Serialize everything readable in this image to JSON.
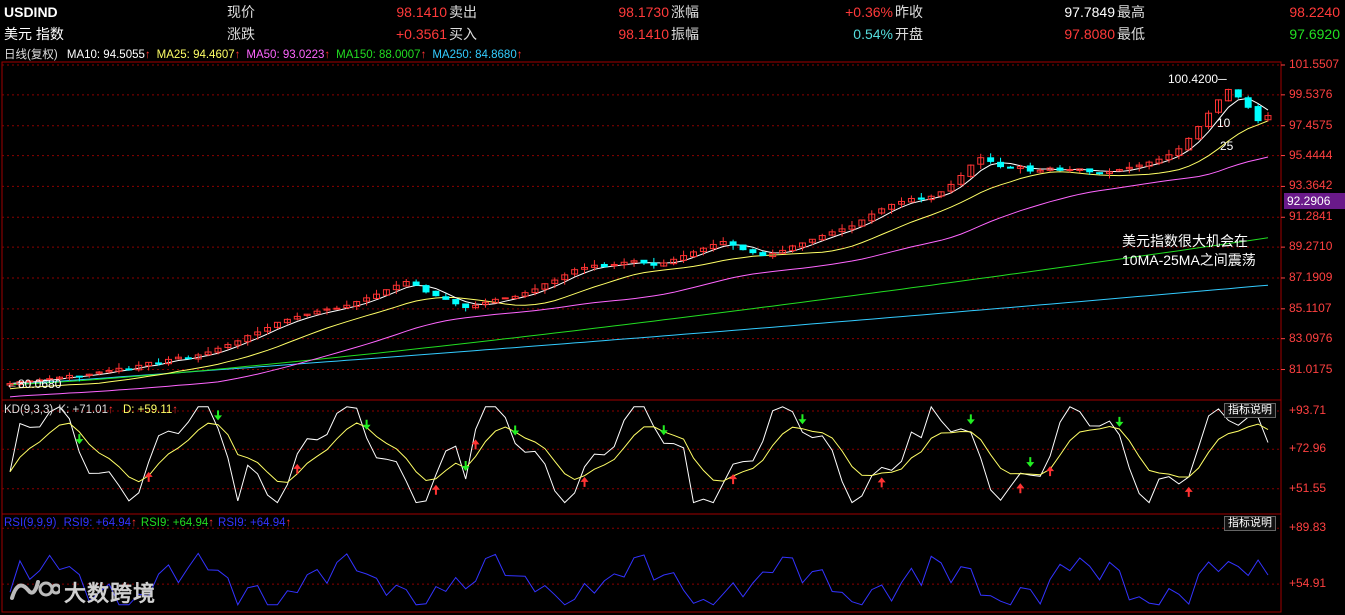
{
  "quote": {
    "symbol": "USDIND",
    "name": "美元 指数",
    "rows": [
      [
        {
          "label": "现价",
          "value": "98.1410"
        },
        {
          "label": "卖出",
          "value": "98.1730"
        },
        {
          "label": "涨幅",
          "value": "+0.36%"
        },
        {
          "label": "昨收",
          "value": "97.7849"
        },
        {
          "label": "最高",
          "value": "98.2240"
        }
      ],
      [
        {
          "label": "涨跌",
          "value": "+0.3561"
        },
        {
          "label": "买入",
          "value": "98.1410"
        },
        {
          "label": "振幅",
          "value": "0.54%"
        },
        {
          "label": "开盘",
          "value": "97.8080"
        },
        {
          "label": "最低",
          "value": "97.6920"
        }
      ]
    ]
  },
  "ma_bar": {
    "title": "日线(复权)",
    "items": [
      {
        "text": "MA10: 94.5055",
        "color": "#ffffff"
      },
      {
        "text": "MA25: 94.4607",
        "color": "#ffff66"
      },
      {
        "text": "MA50: 93.0223",
        "color": "#ff66ff"
      },
      {
        "text": "MA150: 88.0007",
        "color": "#22dd22"
      },
      {
        "text": "MA250: 84.8680",
        "color": "#33ccff"
      }
    ]
  },
  "colors": {
    "up": "#ff3333",
    "down": "#00ffff",
    "grid": "#8b0000",
    "axis": "#ff4040",
    "ma10": "#ffffff",
    "ma25": "#ffff66",
    "ma50": "#ff66ff",
    "ma150": "#22dd22",
    "ma250": "#33ccff",
    "rsi": "#3333ff"
  },
  "chart_data": [
    {
      "type": "candlestick",
      "title": "",
      "yticks": [
        "101.5507",
        "99.5376",
        "97.4575",
        "95.4444",
        "93.3642",
        "91.2841",
        "89.2710",
        "87.1909",
        "85.1107",
        "83.0976",
        "81.0175"
      ],
      "ylim": [
        79.3,
        101.5507
      ],
      "last_price": "92.2906",
      "annotations": {
        "high": "100.4200",
        "low": "80.0680",
        "ma10_tag": "10",
        "ma25_tag": "25",
        "note_line1": "美元指数很大机会在",
        "note_line2": "10MA-25MA之间震荡"
      },
      "closes": [
        80.07,
        80.2,
        80.25,
        80.32,
        80.4,
        80.5,
        80.62,
        80.55,
        80.7,
        80.85,
        80.95,
        81.1,
        81.05,
        81.3,
        81.5,
        81.45,
        81.7,
        81.85,
        81.8,
        82.0,
        82.2,
        82.45,
        82.7,
        82.95,
        83.3,
        83.55,
        83.85,
        84.2,
        84.4,
        84.6,
        84.75,
        84.95,
        85.1,
        85.15,
        85.35,
        85.6,
        85.85,
        86.1,
        86.4,
        86.7,
        86.95,
        86.7,
        86.25,
        86.0,
        85.75,
        85.45,
        85.2,
        85.35,
        85.55,
        85.75,
        85.85,
        85.95,
        86.2,
        86.45,
        86.8,
        87.05,
        87.4,
        87.75,
        87.9,
        88.05,
        87.95,
        88.1,
        88.25,
        88.35,
        88.2,
        88.05,
        88.2,
        88.45,
        88.7,
        88.95,
        89.2,
        89.45,
        89.65,
        89.4,
        89.1,
        88.9,
        88.7,
        88.85,
        89.05,
        89.35,
        89.55,
        89.8,
        90.05,
        90.3,
        90.5,
        90.7,
        91.1,
        91.5,
        91.85,
        92.15,
        92.35,
        92.55,
        92.5,
        92.7,
        93.0,
        93.5,
        94.1,
        94.8,
        95.3,
        95.05,
        94.7,
        94.6,
        94.7,
        94.4,
        94.45,
        94.6,
        94.45,
        94.5,
        94.55,
        94.35,
        94.25,
        94.35,
        94.5,
        94.65,
        94.8,
        95.0,
        95.2,
        95.5,
        95.9,
        96.6,
        97.4,
        98.3,
        99.2,
        99.9,
        99.4,
        98.7,
        97.8,
        98.14
      ],
      "rsi": {
        "label": "RSI(9,9,9)",
        "items": [
          {
            "text": "RSI9: +64.94",
            "color": "#3333ff"
          },
          {
            "text": "RSI9: +64.94",
            "color": "#22dd22"
          },
          {
            "text": "RSI9: +64.94",
            "color": "#3333ff"
          }
        ],
        "yticks": [
          "+89.83",
          "+54.91"
        ],
        "ylim": [
          40,
          95
        ]
      },
      "kd": {
        "label": "KD(9,3,3)",
        "k_text": "K: +71.01",
        "d_text": "D: +59.11",
        "yticks": [
          "+93.71",
          "+72.96",
          "+51.55"
        ],
        "ylim": [
          40,
          97
        ]
      },
      "button_label": "指标说明"
    }
  ],
  "watermark": "大数跨境"
}
